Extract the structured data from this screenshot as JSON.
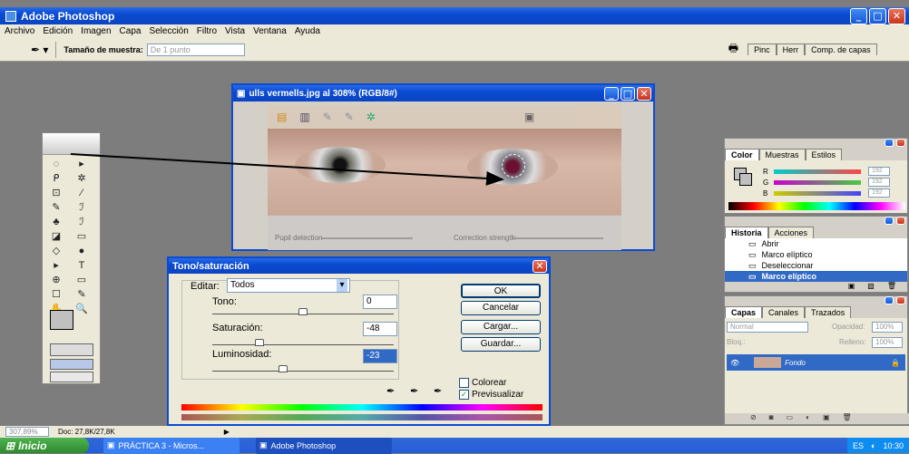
{
  "app": {
    "title": "Adobe Photoshop",
    "window_controls": [
      "_",
      "□",
      "✕"
    ]
  },
  "menu": [
    "Archivo",
    "Edición",
    "Imagen",
    "Capa",
    "Selección",
    "Filtro",
    "Vista",
    "Ventana",
    "Ayuda"
  ],
  "options_bar": {
    "label": "Tamaño de muestra:",
    "value": "De 1 punto",
    "palette_tabs": [
      "Pinc",
      "Herr",
      "Comp. de capas"
    ]
  },
  "document": {
    "title": "ulls vermells.jpg al 308% (RGB/8#)",
    "bottom_left": "Pupil detection",
    "bottom_right": "Correction strength"
  },
  "tools": [
    "◌",
    "▸",
    "ᑭ",
    "✲",
    "⊡",
    "⁄",
    "✎",
    "ℐ",
    "♣",
    "ℐ",
    "◪",
    "▭",
    "◇",
    "●",
    "▸",
    "T",
    "⊕",
    "▭",
    "☐",
    "✎",
    "✋",
    "🔍"
  ],
  "color_panel": {
    "tabs": [
      "Color",
      "Muestras",
      "Estilos"
    ],
    "channels": [
      {
        "label": "R",
        "value": "192"
      },
      {
        "label": "G",
        "value": "192"
      },
      {
        "label": "B",
        "value": "192"
      }
    ]
  },
  "history_panel": {
    "tabs": [
      "Historia",
      "Acciones"
    ],
    "items": [
      "Abrir",
      "Marco elíptico",
      "Deseleccionar",
      "Marco elíptico"
    ],
    "selected_index": 3
  },
  "layers_panel": {
    "tabs": [
      "Capas",
      "Canales",
      "Trazados"
    ],
    "blend": "Normal",
    "opacity_label": "Opacidad:",
    "opacity": "100%",
    "lock_label": "Bloq.:",
    "fill_label": "Relleno:",
    "fill": "100%",
    "layer_name": "Fondo"
  },
  "dialog": {
    "title": "Tono/saturación",
    "edit_label": "Editar:",
    "edit_value": "Todos",
    "hue_label": "Tono:",
    "hue_value": "0",
    "hue_level": 0.5,
    "sat_label": "Saturación:",
    "sat_value": "-48",
    "sat_level": 0.26,
    "lum_label": "Luminosidad:",
    "lum_value": "-23",
    "lum_level": 0.39,
    "ok": "OK",
    "cancel": "Cancelar",
    "load": "Cargar...",
    "save": "Guardar...",
    "colorize": "Colorear",
    "colorize_checked": false,
    "preview": "Previsualizar",
    "preview_checked": true
  },
  "status": {
    "zoom": "307,89%",
    "doc": "Doc: 27,8K/27,8K"
  },
  "taskbar": {
    "start": "Inicio",
    "items": [
      "PRÁCTICA 3 - Micros...",
      "Adobe Photoshop"
    ],
    "lang": "ES",
    "clock": "10:30"
  },
  "colors": {
    "accent": "#0a4bd1",
    "workspace": "#7d7d7d",
    "panel": "#d4d0c8",
    "taskbar": "#245edb",
    "start": "#3d9c3d"
  }
}
